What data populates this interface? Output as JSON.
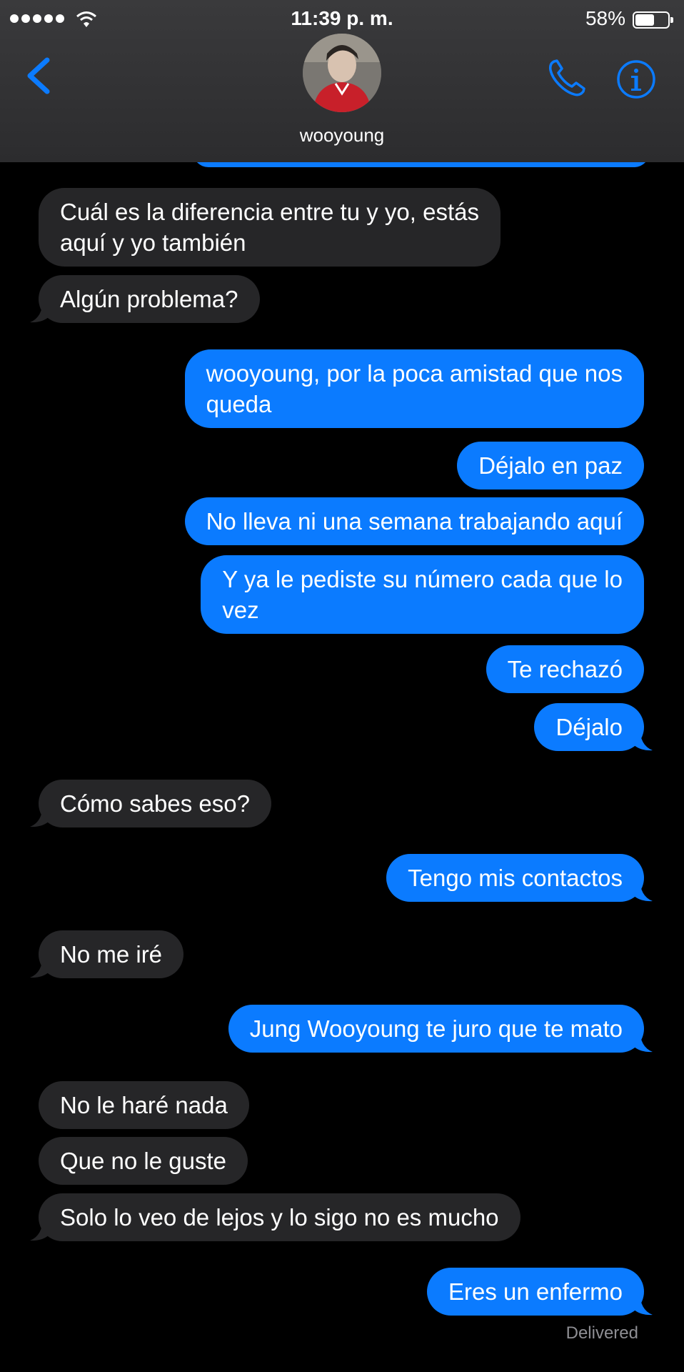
{
  "status_bar": {
    "time": "11:39 p. m.",
    "battery": "58%",
    "battery_level": 0.58
  },
  "header": {
    "contact_name": "wooyoung",
    "icons": [
      "back-chevron-icon",
      "phone-icon",
      "info-icon"
    ],
    "accent_color": "#0b7bff"
  },
  "messages": [
    {
      "from": "them",
      "text": "Cuál es la diferencia entre tu y yo, estás\naquí y yo también"
    },
    {
      "from": "them",
      "text": "Algún problema?"
    },
    {
      "from": "me",
      "text": "wooyoung, por la poca amistad que nos\nqueda"
    },
    {
      "from": "me",
      "text": "Déjalo en paz"
    },
    {
      "from": "me",
      "text": "No lleva ni una semana trabajando aquí"
    },
    {
      "from": "me",
      "text": "Y ya le pediste su número cada que lo\nvez"
    },
    {
      "from": "me",
      "text": "Te rechazó"
    },
    {
      "from": "me",
      "text": "Déjalo"
    },
    {
      "from": "them",
      "text": "Cómo sabes eso?"
    },
    {
      "from": "me",
      "text": "Tengo mis contactos"
    },
    {
      "from": "them",
      "text": "No me iré"
    },
    {
      "from": "me",
      "text": "Jung Wooyoung te juro que te mato"
    },
    {
      "from": "them",
      "text": "No le haré nada"
    },
    {
      "from": "them",
      "text": "Que no le guste"
    },
    {
      "from": "them",
      "text": "Solo lo veo de lejos y lo sigo no es mucho"
    },
    {
      "from": "me",
      "text": "Eres un enfermo"
    }
  ],
  "delivered_label": "Delivered"
}
